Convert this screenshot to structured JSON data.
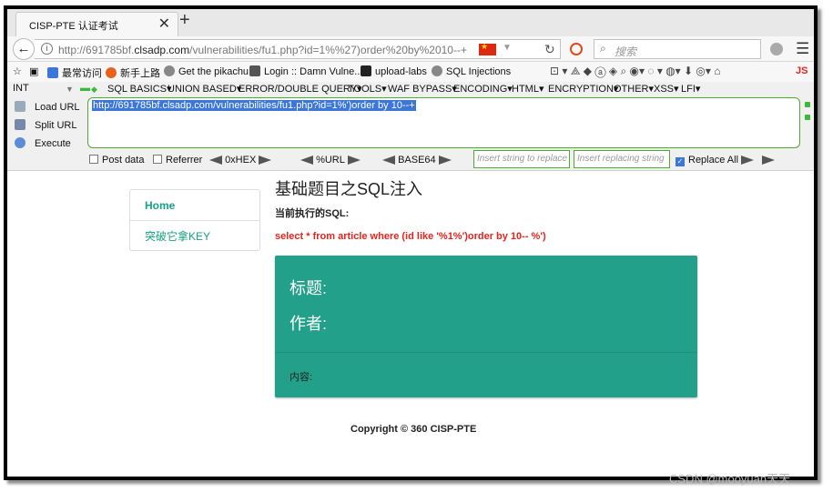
{
  "tab": {
    "title": "CISP-PTE 认证考试",
    "close": "✕",
    "new_tab": "+"
  },
  "nav": {
    "back": "←",
    "url_prefix": "http://691785bf.",
    "url_domain": "clsadp.com",
    "url_suffix": "/vulnerabilities/fu1.php?id=1%%27)order%20by%2010--+",
    "url_dropdown": "▼",
    "reload": "↻",
    "search_placeholder": "搜索",
    "menu": "☰"
  },
  "bookmarks": [
    {
      "label": "最常访问",
      "color": "#3b76d8"
    },
    {
      "label": "新手上路",
      "color": "#e8621b"
    },
    {
      "label": "Get the pikachu",
      "color": "#888888"
    },
    {
      "label": "Login :: Damn Vulne...",
      "color": "#555555"
    },
    {
      "label": "upload-labs",
      "color": "#222222"
    },
    {
      "label": "SQL Injections",
      "color": "#888888"
    }
  ],
  "bookmarks_right": "⊡ ▾ ⟁ ◆ ⓐ ◈ ⌕ ◉▾ ◌ ▾ ◍▾ ⬇ ◎▾ ⌂",
  "bookmarks_js": "JS",
  "hackbar": {
    "type_select": "INT",
    "menu": [
      "SQL BASICS▾",
      "UNION BASED▾",
      "ERROR/DOUBLE QUERY▾",
      "TOOLS▾",
      "WAF BYPASS▾",
      "ENCODING▾",
      "HTML▾",
      "ENCRYPTION▾",
      "OTHER▾",
      "XSS▾",
      "LFI▾"
    ],
    "load_url": "Load URL",
    "split_url": "Split URL",
    "execute": "Execute",
    "url_value": "http://691785bf.clsadp.com/vulnerabilities/fu1.php?id=1%')order by 10--+",
    "post_data": "Post data",
    "referrer": "Referrer",
    "hex": "0xHEX",
    "url_enc": "%URL",
    "base64": "BASE64",
    "insert_placeholder": "Insert string to replace",
    "replace_placeholder": "Insert replacing string",
    "replace_all": "Replace All"
  },
  "sidebar": {
    "items": [
      {
        "label": "Home"
      },
      {
        "label": "突破它拿KEY"
      }
    ]
  },
  "main": {
    "title": "基础题目之SQL注入",
    "sql_label": "当前执行的SQL:",
    "sql_text": "select * from article where (id like '%1%')order by 10-- %')",
    "panel_title": "标题:",
    "panel_author": "作者:",
    "panel_content": "内容:",
    "copyright": "Copyright © 360 CISP-PTE"
  },
  "watermark": "CSDN @mooyuan天天",
  "colors": {
    "accent": "#22a08a",
    "sql_red": "#e8221b",
    "link_green": "#16a085",
    "hackbar_border": "#4cae2c"
  }
}
